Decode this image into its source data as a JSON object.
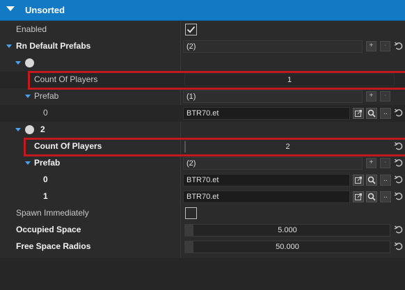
{
  "section": {
    "title": "Unsorted"
  },
  "rows": {
    "enabled": {
      "label": "Enabled",
      "checked": true
    },
    "prefabs": {
      "label": "Rn Default Prefabs",
      "value": "(2)"
    },
    "item0": {
      "label": ""
    },
    "item0_count": {
      "label": "Count Of Players",
      "value": "1"
    },
    "item0_prefab": {
      "label": "Prefab",
      "value": "(1)"
    },
    "item0_prefab_0": {
      "label": "0",
      "value": "BTR70.et"
    },
    "item1": {
      "label": "2"
    },
    "item1_count": {
      "label": "Count Of Players",
      "value": "2"
    },
    "item1_prefab": {
      "label": "Prefab",
      "value": "(2)"
    },
    "item1_prefab_0": {
      "label": "0",
      "value": "BTR70.et"
    },
    "item1_prefab_1": {
      "label": "1",
      "value": "BTR70.et"
    },
    "spawn": {
      "label": "Spawn Immediately",
      "checked": false
    },
    "occupied": {
      "label": "Occupied Space",
      "value": "5.000"
    },
    "radios": {
      "label": "Free Space Radios",
      "value": "50.000"
    }
  },
  "buttons": {
    "add": "+",
    "remove": "-",
    "browse": "..",
    "search_icon": "search-icon",
    "open_icon": "open-external-icon",
    "reset_icon": "reset-icon"
  },
  "colors": {
    "header": "#1279c5",
    "highlight": "#c1191e",
    "arrow": "#4aa3ec"
  }
}
